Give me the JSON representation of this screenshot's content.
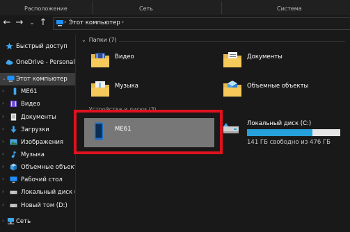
{
  "ribbon": {
    "groups": [
      "Расположение",
      "Сеть",
      "Система"
    ]
  },
  "toolbar": {
    "address_path": "Этот компьютер",
    "address_sep": "›"
  },
  "sidebar": {
    "items": [
      {
        "label": "Быстрый доступ",
        "icon": "star-icon"
      },
      {
        "label": "OneDrive - Personal",
        "icon": "cloud-icon"
      },
      {
        "label": "Этот компьютер",
        "icon": "computer-icon"
      },
      {
        "label": "ME61",
        "icon": "phone-icon"
      },
      {
        "label": "Видео",
        "icon": "video-icon"
      },
      {
        "label": "Документы",
        "icon": "document-icon"
      },
      {
        "label": "Загрузки",
        "icon": "download-icon"
      },
      {
        "label": "Изображения",
        "icon": "image-icon"
      },
      {
        "label": "Музыка",
        "icon": "music-icon"
      },
      {
        "label": "Объемные объекты",
        "icon": "cube-icon"
      },
      {
        "label": "Рабочий стол",
        "icon": "desktop-icon"
      },
      {
        "label": "Локальный диск (C:",
        "icon": "disk-icon"
      },
      {
        "label": "Новый том (D:)",
        "icon": "disk-icon"
      },
      {
        "label": "Сеть",
        "icon": "network-icon"
      }
    ]
  },
  "main": {
    "folders_header": "Папки (7)",
    "devices_header": "Устройства и диски (3)",
    "folders": [
      {
        "label": "Видео",
        "icon": "video-folder-icon"
      },
      {
        "label": "Документы",
        "icon": "documents-folder-icon"
      },
      {
        "label": "Музыка",
        "icon": "music-folder-icon"
      },
      {
        "label": "Объемные объекты",
        "icon": "3d-objects-folder-icon"
      }
    ],
    "device": {
      "label": "ME61",
      "icon": "phone-icon"
    },
    "disk": {
      "name": "Локальный диск (C:)",
      "free_text": "141 ГБ свободно из 476 ГБ",
      "used_fraction": 0.7
    }
  },
  "colors": {
    "background": "#191919",
    "selection": "#777777",
    "highlight_box": "#e0121d",
    "disk_bar": "#26a0da"
  }
}
